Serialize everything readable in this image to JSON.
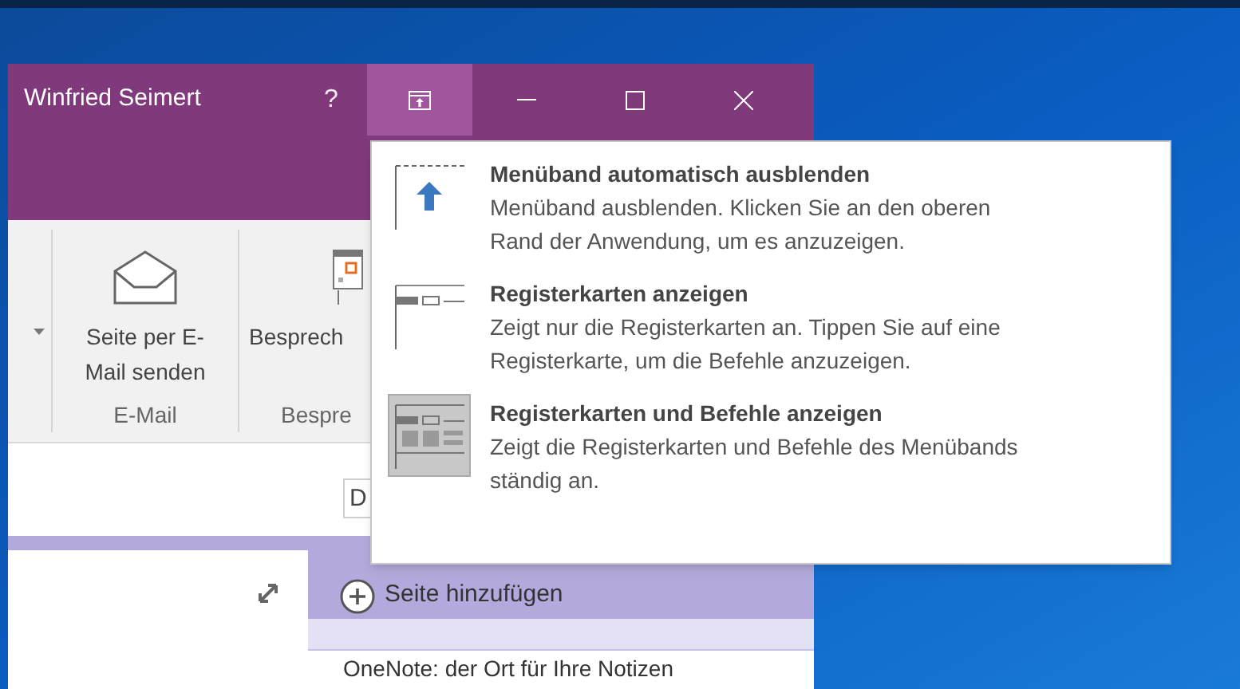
{
  "window": {
    "user": "Winfried Seimert",
    "help": "?"
  },
  "ribbon": {
    "groups": [
      {
        "kind": "email",
        "button": "Seite per E-Mail senden",
        "label": "E-Mail"
      },
      {
        "kind": "meeting",
        "button": "Besprech",
        "label": "Bespre"
      }
    ]
  },
  "search_field": {
    "value": "D"
  },
  "pages": {
    "add_page": "Seite hinzufügen",
    "note_title": "OneNote: der Ort für Ihre Notizen"
  },
  "ribbon_options_menu": {
    "items": [
      {
        "kind": "autohide",
        "title": "Menüband automatisch ausblenden",
        "description": "Menüband ausblenden. Klicken Sie an den oberen Rand der Anwendung, um es anzuzeigen.",
        "selected": false
      },
      {
        "kind": "tabs",
        "title": "Registerkarten anzeigen",
        "description": "Zeigt nur die Registerkarten an. Tippen Sie auf eine Registerkarte, um die Befehle anzuzeigen.",
        "selected": false
      },
      {
        "kind": "tabs_commands",
        "title": "Registerkarten und Befehle anzeigen",
        "description": "Zeigt die Registerkarten und Befehle des Menübands ständig an.",
        "selected": true
      }
    ]
  }
}
